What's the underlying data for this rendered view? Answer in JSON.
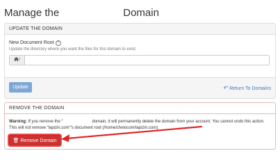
{
  "page": {
    "title_prefix": "Manage the",
    "title_suffix": "Domain"
  },
  "update_panel": {
    "heading": "UPDATE THE DOMAIN",
    "field_label": "New Document Root",
    "field_hint": "Update the directory where you want the files for this domain to exist.",
    "input_prefix": "/",
    "input_value": "",
    "update_button": "Update",
    "return_link": "Return To Domains"
  },
  "remove_panel": {
    "heading": "REMOVE THE DOMAIN",
    "warning_label": "Warning:",
    "warning_part1": "If you remove the “",
    "warning_part2": "domain, it will permanently delete the domain from your account. You cannot undo this action. This will not remove “lapizin.com”'s document root (/home/chelocom/lapizin.com).",
    "remove_button": "Remove Domain"
  },
  "icons": {
    "help": "question-circle-icon",
    "home": "home-icon",
    "return": "return-arrow-icon",
    "trash": "trash-icon"
  },
  "colors": {
    "accent_blue": "#3a7bbf",
    "update_button": "#7fa7d6",
    "danger": "#cf3131",
    "annotation_arrow": "#e02424"
  }
}
